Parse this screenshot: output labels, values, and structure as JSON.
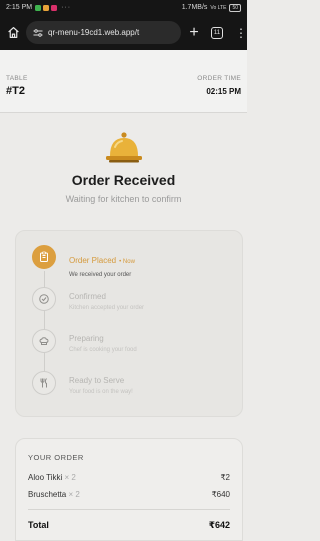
{
  "status_bar": {
    "time": "2:15 PM",
    "more": "···",
    "speed": "1.7MB/s",
    "signal": "Vo LTE",
    "battery": "50"
  },
  "browser": {
    "url": "qr-menu-19cd1.web.app/t",
    "plus_label": "+",
    "tab_count": "11",
    "menu_glyph": "⋮"
  },
  "header": {
    "table_label": "TABLE",
    "table_value": "#T2",
    "order_time_label": "ORDER TIME",
    "order_time_value": "02:15 PM"
  },
  "hero": {
    "icon": "service-bell-icon",
    "title": "Order Received",
    "subtitle": "Waiting for kitchen to confirm"
  },
  "timeline": {
    "now_badge": "• Now",
    "steps": [
      {
        "name": "Order Placed",
        "desc": "We received your order",
        "icon": "receipt-icon",
        "status": "active"
      },
      {
        "name": "Confirmed",
        "desc": "Kitchen accepted your order",
        "icon": "check-circle-icon",
        "status": "pending"
      },
      {
        "name": "Preparing",
        "desc": "Chef is cooking your food",
        "icon": "chef-hat-icon",
        "status": "pending"
      },
      {
        "name": "Ready to Serve",
        "desc": "Your food is on the way!",
        "icon": "cutlery-icon",
        "status": "pending"
      }
    ]
  },
  "order": {
    "title": "YOUR ORDER",
    "items": [
      {
        "name": "Aloo Tikki",
        "qty": "× 2",
        "price": "₹2"
      },
      {
        "name": "Bruschetta",
        "qty": "× 2",
        "price": "₹640"
      }
    ],
    "total_label": "Total",
    "total_value": "₹642"
  },
  "colors": {
    "accent": "#dc9f3f",
    "background": "#ecebe9",
    "browser_chrome": "#151515"
  }
}
